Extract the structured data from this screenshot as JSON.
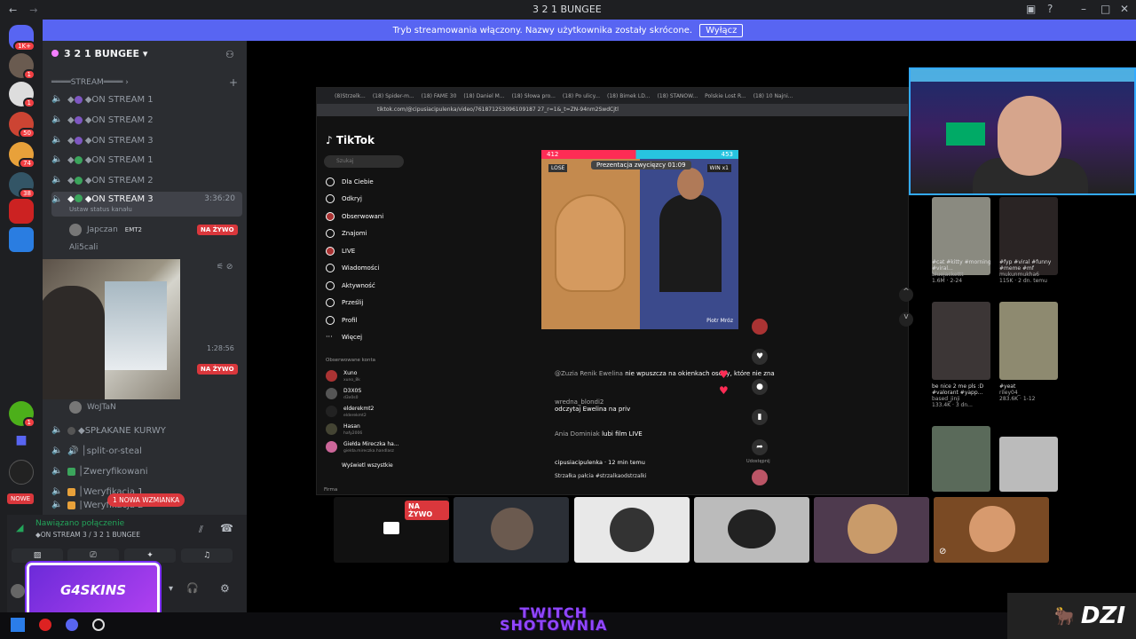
{
  "window": {
    "title": "3 2 1 BUNGEE"
  },
  "banner": {
    "text": "Tryb streamowania włączony. Nazwy użytkownika zostały skrócone.",
    "button": "Wyłącz"
  },
  "guild_badges": [
    "1K+",
    "1",
    "1",
    "50",
    "74",
    "38",
    "1",
    "1"
  ],
  "server": {
    "name": "3 2 1 BUNGEE",
    "category": "STREAM"
  },
  "channels": [
    {
      "name": "◆ON STREAM 1",
      "orb": "#7e57c2"
    },
    {
      "name": "◆ON STREAM 2",
      "orb": "#7e57c2"
    },
    {
      "name": "◆ON STREAM 3",
      "orb": "#7e57c2"
    },
    {
      "name": "◆ON STREAM 1",
      "orb": "#3ba55c"
    },
    {
      "name": "◆ON STREAM 2",
      "orb": "#3ba55c"
    },
    {
      "name": "◆ON STREAM 3",
      "orb": "#3ba55c",
      "time": "3:36:20",
      "status": "Ustaw status kanału"
    }
  ],
  "voice_users": [
    {
      "name": "Japczan",
      "tag": "EMT2",
      "live": "NA ŻYWO"
    },
    {
      "name": "Ali5cali"
    },
    {
      "name": "WoJTaN"
    }
  ],
  "cam_time": "1:28:56",
  "cam_live": "NA ŻYWO",
  "channels2": [
    {
      "name": "◆SPŁAKANE KURWY"
    },
    {
      "name": "split-or-steal"
    },
    {
      "name": "Zweryfikowani"
    },
    {
      "name": "Weryfikacja 1"
    },
    {
      "name": "Weryfikacja 2"
    }
  ],
  "mention": "1 NOWA WZMIANKA",
  "nowe": "NOWE",
  "voice_panel": {
    "title": "Nawiązano połączenie",
    "subtitle": "◆ON STREAM 3 / 3 2 1 BUNGEE"
  },
  "sponsor": "G4SKINS",
  "browser": {
    "tabs": [
      "(8)Strzelk...",
      "(18) Spider-m...",
      "(18) FAME 30",
      "(18) Daniel M...",
      "(18) Słowa pro...",
      "(18) Po ulicy...",
      "(18) Bimek LD...",
      "(18) STANOW...",
      "Polskie Lost R...",
      "(18) 10 Najni..."
    ],
    "url": "tiktok.com/@cipusiacipulenka/video/761871253096109187 27_r=1&_t=ZN-94nm2SwdCjtl"
  },
  "tiktok": {
    "logo": "TikTok",
    "search": "Szukaj",
    "nav": [
      "Dla Ciebie",
      "Odkryj",
      "Obserwowani",
      "Znajomi",
      "LIVE",
      "Wiadomości",
      "Aktywność",
      "Prześlij",
      "Profil",
      "Więcej"
    ],
    "followed_title": "Obserwowane konta",
    "followed": [
      {
        "name": "Xuno",
        "handle": "xuno_8k"
      },
      {
        "name": "D3X0S",
        "handle": "d3x0s0"
      },
      {
        "name": "elderekmt2",
        "handle": "elderekmt2"
      },
      {
        "name": "Hasan",
        "handle": "hafy2006"
      },
      {
        "name": "Giełda Mireczka ha...",
        "handle": "gielda.mireczka.handlasz"
      }
    ],
    "see_all": "Wyświetl wszystkie",
    "footer": "Firma",
    "battle": {
      "left_score": "412",
      "right_score": "453",
      "lose": "LOSE",
      "win": "WIN x1",
      "timer": "Prezentacja zwycięzcy 01:09",
      "host": "Piotr Mróz"
    },
    "comments": [
      {
        "user": "@Zuzia Renik Ewelina",
        "text": "nie wpuszcza na okienkach osoby, które nie zna"
      },
      {
        "user": "wredna_blondi2",
        "text": "odczytaj Ewelina na priv"
      },
      {
        "user": "Ania Dominiak",
        "text": "lubi film LIVE"
      }
    ],
    "author": "cipusiacipulenka · 12 min temu",
    "caption": "Strzałka pałcia #strzalkaodstrzalki",
    "share_label": "Udostępnij"
  },
  "strip": {
    "live": "NA ŻYWO"
  },
  "grid": [
    {
      "cap": "#cat #kitty #morning #viral...",
      "user": "bluejackettt",
      "stats": "1.6M · 2-24"
    },
    {
      "cap": "#fyp #viral #funny #meme #mf",
      "user": "mukunmukha6",
      "stats": "115K · 2 dn. temu"
    },
    {
      "cap": "be nice 2 me pls :D #valorant #yapp...",
      "user": "based_jinji",
      "stats": "133.4K · 3 dn..."
    },
    {
      "cap": "#yeat",
      "user": "riley04_",
      "stats": "283.6K · 1-12"
    }
  ],
  "overlay": {
    "twitch_line1": "TWITCH",
    "twitch_line2": "SHOTOWNIA",
    "dzi": "DZI"
  }
}
